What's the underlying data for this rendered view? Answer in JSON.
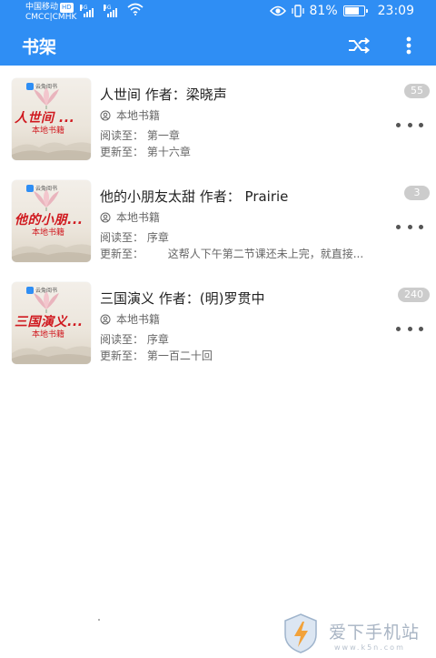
{
  "status_bar": {
    "carrier_line1": "中国移动",
    "carrier_hd": "HD",
    "carrier_line2": "CMCC|CMHK",
    "net1": "4G",
    "net2": "4G",
    "battery_percent": "81%",
    "battery_level": 0.81,
    "time": "23:09",
    "icons": [
      "signal-icon",
      "wifi-icon",
      "eye-icon",
      "vibrate-icon",
      "battery-icon"
    ]
  },
  "app_bar": {
    "title": "书架",
    "actions": [
      "shuffle-icon",
      "more-vertical-icon"
    ],
    "color": "#2f8ef4"
  },
  "books": [
    {
      "title": "人世间 作者：梁晓声",
      "cover_title": "人世间 ...",
      "cover_sub": "本地书籍",
      "source": "本地书籍",
      "read_label": "阅读至：",
      "read_value": "第一章",
      "update_label": "更新至：",
      "update_value": "第十六章",
      "badge": "55"
    },
    {
      "title": "他的小朋友太甜 作者：  Prairie",
      "cover_title": "他的小朋...",
      "cover_sub": "本地书籍",
      "source": "本地书籍",
      "read_label": "阅读至：",
      "read_value": "序章",
      "update_label": "更新至：",
      "update_value": "      这帮人下午第二节课还未上完，就直接...",
      "badge": "3"
    },
    {
      "title": "三国演义 作者：(明)罗贯中",
      "cover_title": "三国演义...",
      "cover_sub": "本地书籍",
      "source": "本地书籍",
      "read_label": "阅读至：",
      "read_value": "序章",
      "update_label": "更新至：",
      "update_value": "第一百二十回",
      "badge": "240"
    }
  ],
  "cover_logo_text": "云兔阅书",
  "watermark": {
    "text": "爱下手机站",
    "url": "www.k5n.com"
  }
}
